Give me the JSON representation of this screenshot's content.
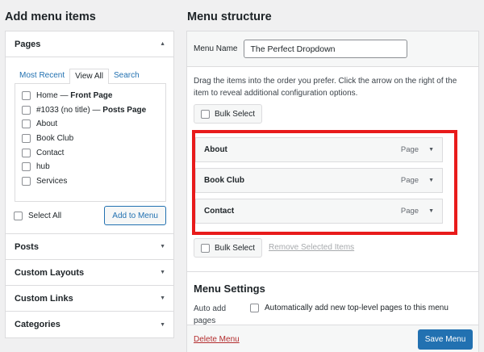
{
  "left": {
    "heading": "Add menu items",
    "pages": {
      "title": "Pages",
      "tabs": [
        "Most Recent",
        "View All",
        "Search"
      ],
      "active_tab": "View All",
      "items": [
        {
          "label": "Home",
          "suffix": "Front Page"
        },
        {
          "label": "#1033 (no title)",
          "suffix": "Posts Page"
        },
        {
          "label": "About",
          "suffix": ""
        },
        {
          "label": "Book Club",
          "suffix": ""
        },
        {
          "label": "Contact",
          "suffix": ""
        },
        {
          "label": "hub",
          "suffix": ""
        },
        {
          "label": "Services",
          "suffix": ""
        }
      ],
      "select_all": "Select All",
      "add_button": "Add to Menu"
    },
    "sections": [
      "Posts",
      "Custom Layouts",
      "Custom Links",
      "Categories"
    ]
  },
  "right": {
    "heading": "Menu structure",
    "menu_name_label": "Menu Name",
    "menu_name_value": "The Perfect Dropdown",
    "instructions": "Drag the items into the order you prefer. Click the arrow on the right of the item to reveal additional configuration options.",
    "bulk_select": "Bulk Select",
    "remove_selected": "Remove Selected Items",
    "items": [
      {
        "title": "About",
        "type": "Page"
      },
      {
        "title": "Book Club",
        "type": "Page"
      },
      {
        "title": "Contact",
        "type": "Page"
      }
    ],
    "settings_title": "Menu Settings",
    "auto_add_label": "Auto add pages",
    "auto_add_option": "Automatically add new top-level pages to this menu",
    "delete_menu": "Delete Menu",
    "save_menu": "Save Menu"
  },
  "colors": {
    "highlight": "#e81b1b",
    "primary": "#2271b1",
    "danger": "#b32d2e"
  }
}
